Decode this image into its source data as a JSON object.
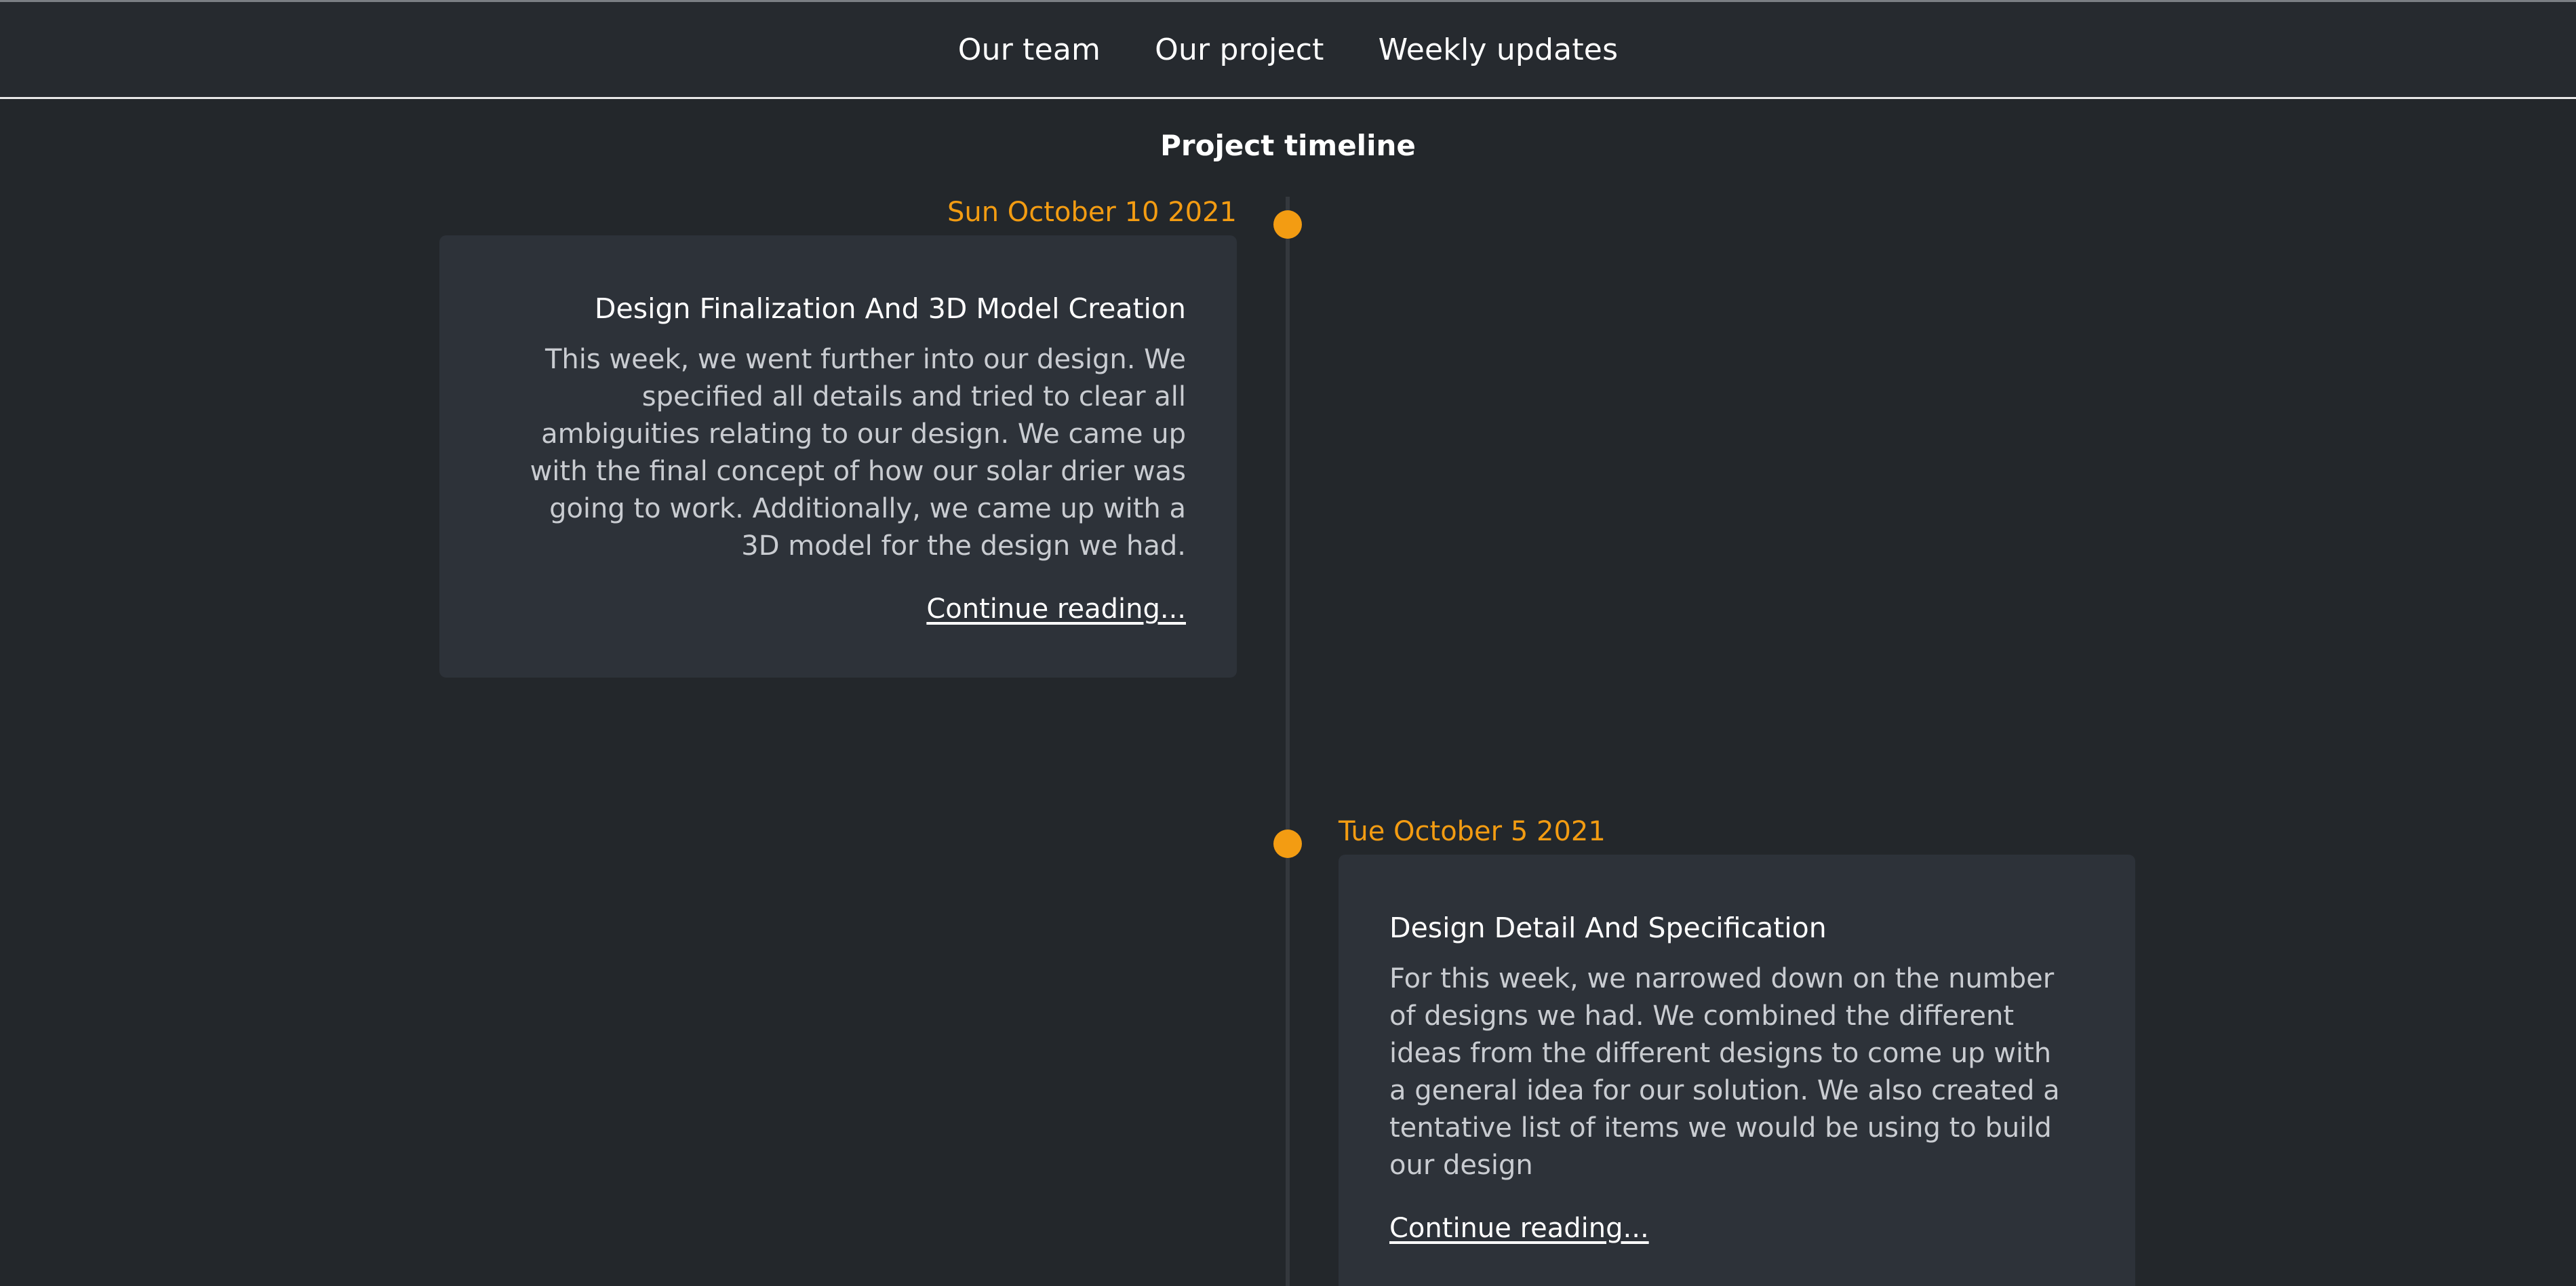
{
  "nav": {
    "items": [
      "Our team",
      "Our project",
      "Weekly updates"
    ]
  },
  "page": {
    "title": "Project timeline"
  },
  "timeline": {
    "entries": [
      {
        "date": "Sun October 10 2021",
        "title": "Design Finalization And 3D Model Creation",
        "body": "This week, we went further into our design. We specified all details and tried to clear all ambiguities relating to our design. We came up with the final concept of how our solar drier was going to work. Additionally, we came up with a 3D model for the design we had.",
        "link": "Continue reading..."
      },
      {
        "date": "Tue October 5 2021",
        "title": "Design Detail And Specification",
        "body": "For this week, we narrowed down on the number of designs we had. We combined the different ideas from the different designs to come up with a general idea for our solution. We also created a tentative list of items we would be using to build our design",
        "link": "Continue reading..."
      }
    ]
  },
  "colors": {
    "background": "#23272b",
    "card": "#2d3239",
    "accent": "#f39c12",
    "text": "#ffffff"
  }
}
